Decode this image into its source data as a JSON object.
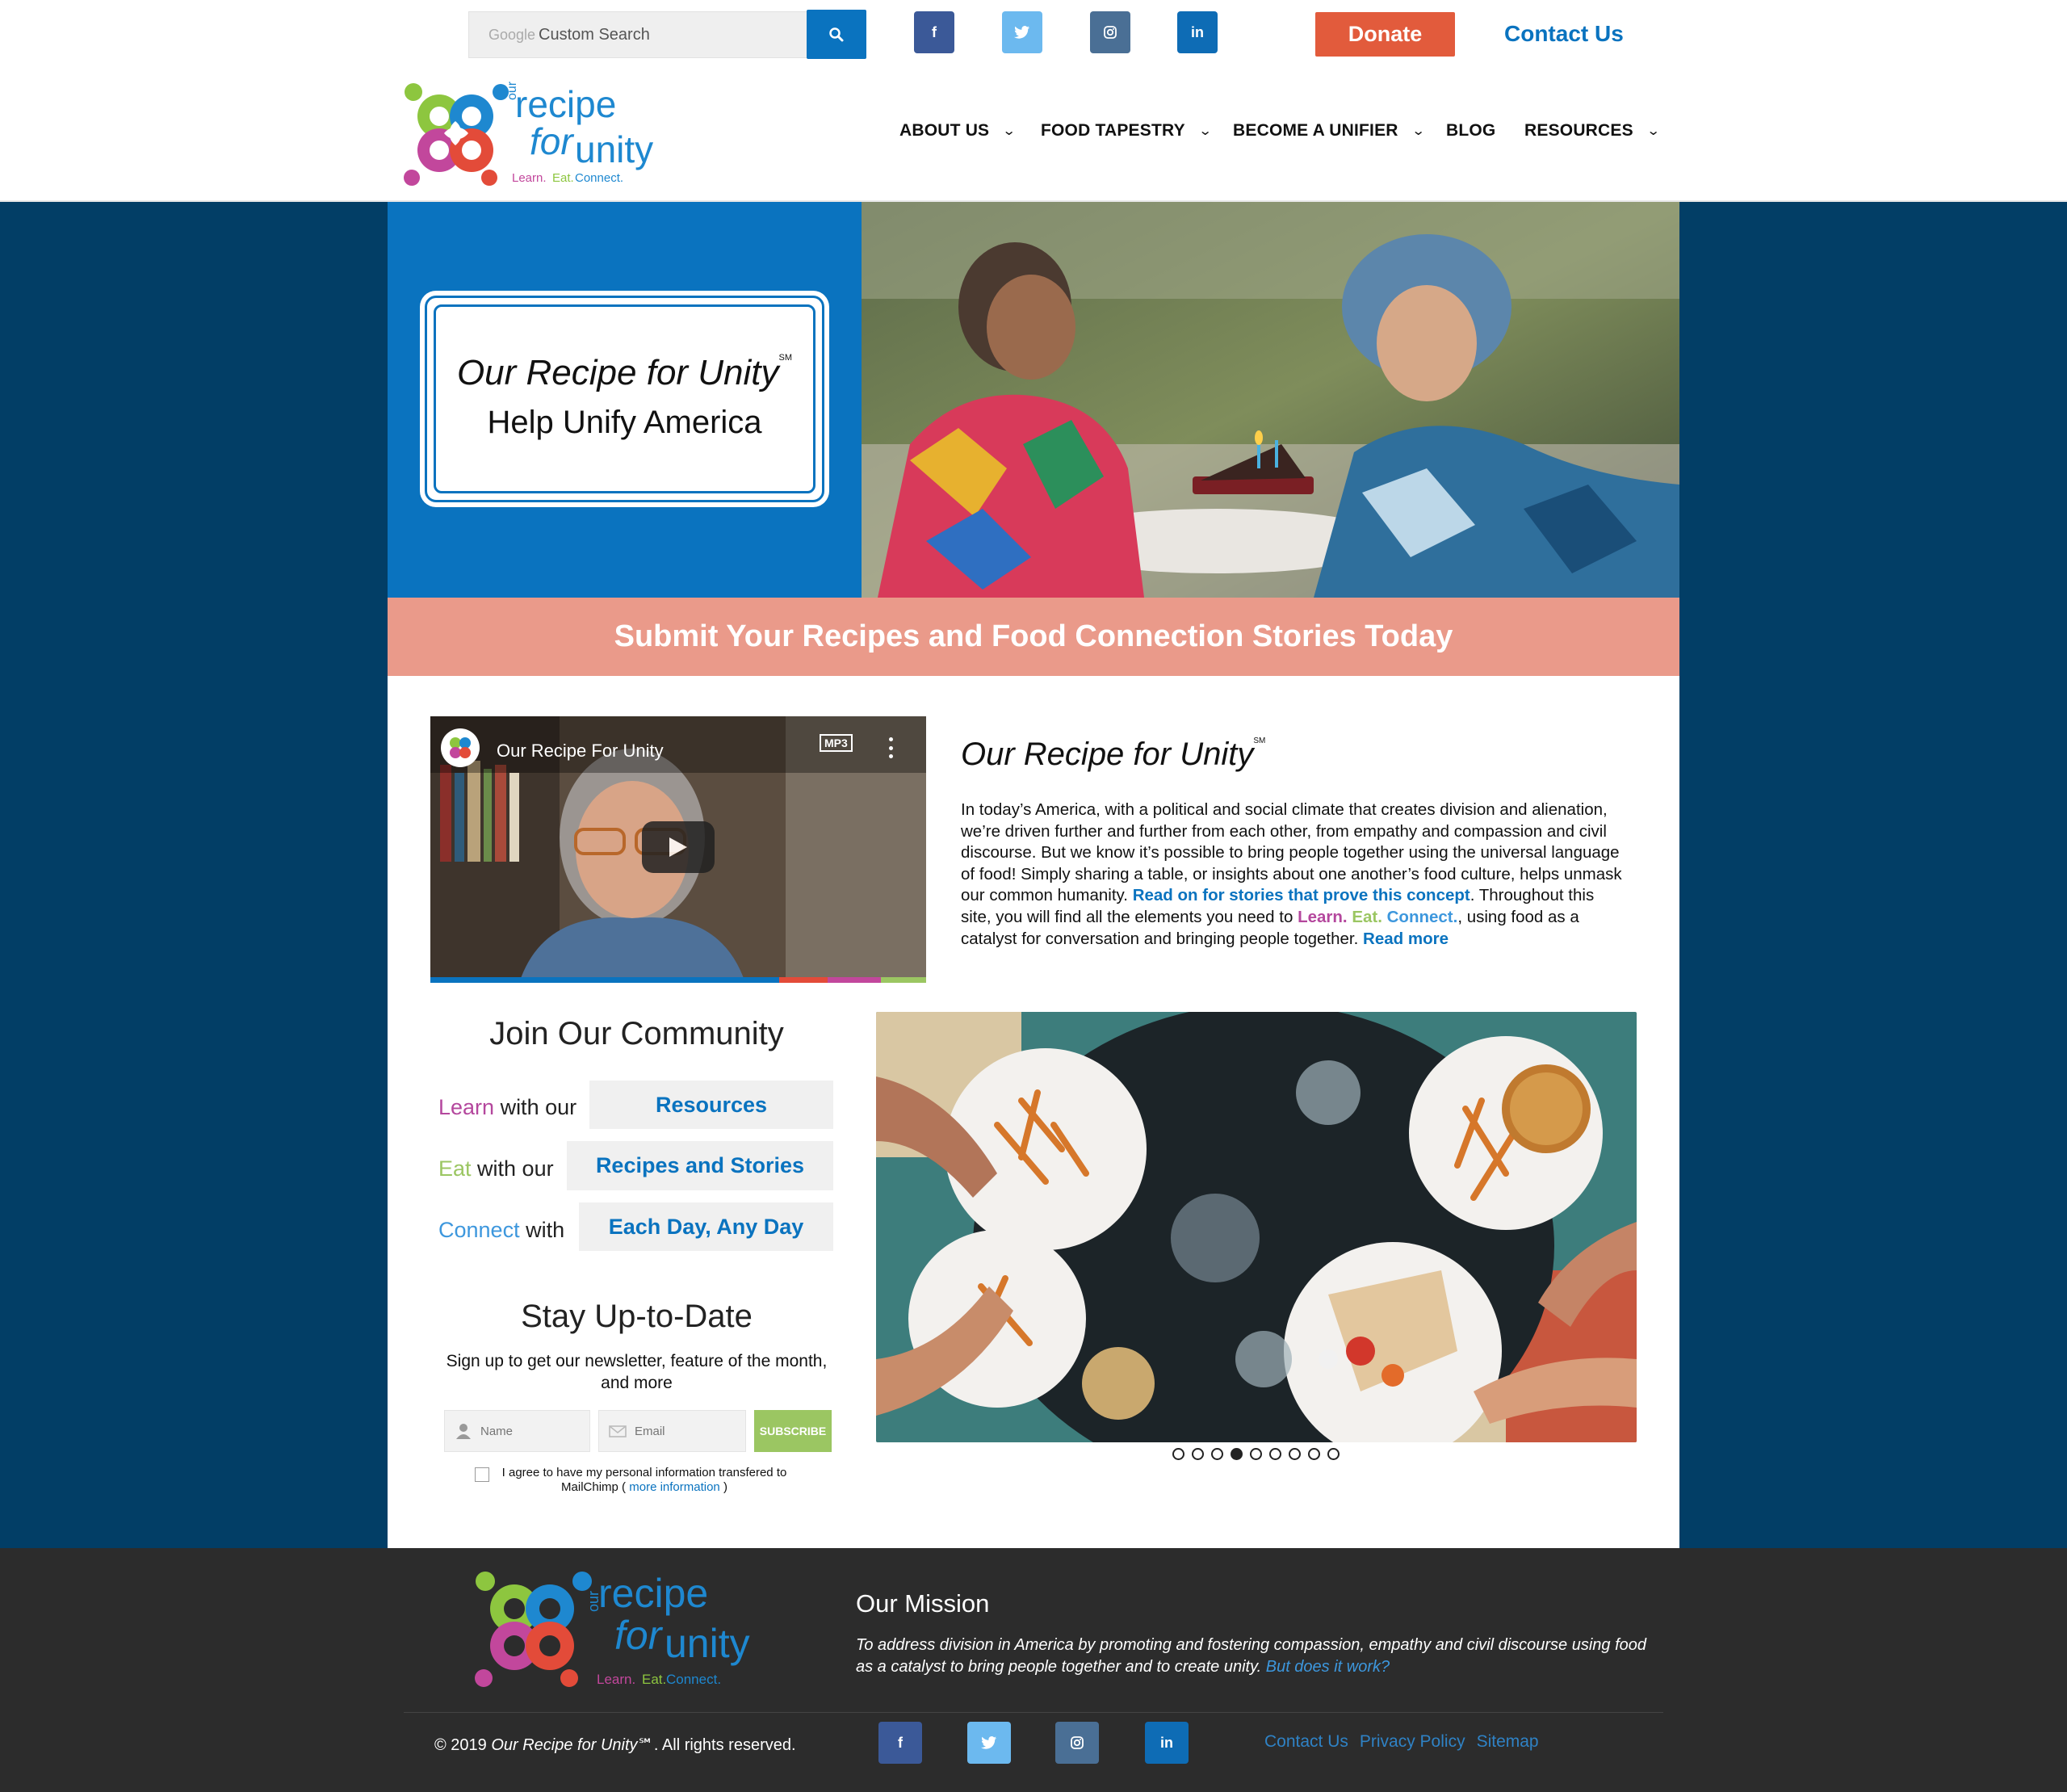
{
  "topbar": {
    "search_brand": "Google",
    "search_placeholder": "Custom Search",
    "social": [
      "f",
      "t",
      "ig",
      "in"
    ],
    "donate_label": "Donate",
    "contact_label": "Contact Us"
  },
  "logo": {
    "word_our": "our",
    "word_recipe": "recipe",
    "word_for": "for",
    "word_unity": "unity",
    "tagline_learn": "Learn.",
    "tagline_eat": "Eat.",
    "tagline_connect": "Connect."
  },
  "nav": {
    "items": [
      {
        "label": "ABOUT US",
        "has_menu": true
      },
      {
        "label": "FOOD TAPESTRY",
        "has_menu": true
      },
      {
        "label": "BECOME A UNIFIER",
        "has_menu": true
      },
      {
        "label": "BLOG",
        "has_menu": false
      },
      {
        "label": "RESOURCES",
        "has_menu": true
      }
    ]
  },
  "hero": {
    "title": "Our Recipe for Unity",
    "title_mark": "SM",
    "subtitle": "Help Unify America"
  },
  "banner": {
    "text": "Submit Your Recipes and Food Connection Stories Today"
  },
  "video": {
    "title": "Our Recipe For Unity",
    "badge": "MP3"
  },
  "about": {
    "title": "Our Recipe for Unity",
    "title_mark": "SM",
    "text_1": "In today’s America, with a political and social climate that creates division and alienation, we’re driven further and further from each other, from empathy and compassion and civil discourse. But we know it’s possible to bring people together using the universal language of food! Simply sharing a table, or insights about one another’s food culture, helps unmask our common humanity. ",
    "link_stories": "Read on for stories that prove this concept",
    "text_2": ". Throughout this site, you will find all the elements you need to ",
    "learn": "Learn.",
    "eat": "Eat.",
    "connect": "Connect.",
    "text_3": ", using food as a catalyst for conversation and bringing people together. ",
    "read_more": "Read more"
  },
  "community": {
    "title": "Join Our Community",
    "rows": [
      {
        "keyword": "Learn",
        "suffix": " with our",
        "button": "Resources"
      },
      {
        "keyword": "Eat",
        "suffix": " with our",
        "button": "Recipes and Stories"
      },
      {
        "keyword": "Connect",
        "suffix": " with",
        "button": "Each Day, Any Day"
      }
    ]
  },
  "newsletter": {
    "title": "Stay Up-to-Date",
    "subtitle": "Sign up to get our newsletter, feature of the month, and more",
    "name_placeholder": "Name",
    "email_placeholder": "Email",
    "subscribe_label": "SUBSCRIBE",
    "agree_text": "I agree to have my personal information transfered to MailChimp ( ",
    "agree_link": "more information",
    "agree_end": " )"
  },
  "carousel": {
    "total_slides": 9,
    "active_index": 3
  },
  "footer": {
    "mission_title": "Our Mission",
    "mission_text": "To address division in America by promoting and fostering compassion, empathy and civil discourse using food as a catalyst to bring people together and to create unity. ",
    "mission_link": "But does it work?",
    "copyright_prefix": "© 2019 ",
    "copyright_name": "Our Recipe for Unity",
    "copyright_mark": "℠",
    "copyright_suffix": ". All rights reserved.",
    "links": [
      "Contact Us",
      "Privacy Policy",
      "Sitemap"
    ]
  },
  "colors": {
    "brand_blue": "#0a73bf",
    "dark_blue": "#023e66",
    "donate_orange": "#e25b3c",
    "banner_salmon": "#ea9a8a",
    "learn_purple": "#b4479d",
    "eat_green": "#9bc662",
    "connect_blue": "#3d97dd",
    "footer_bg": "#2c2c2c"
  }
}
